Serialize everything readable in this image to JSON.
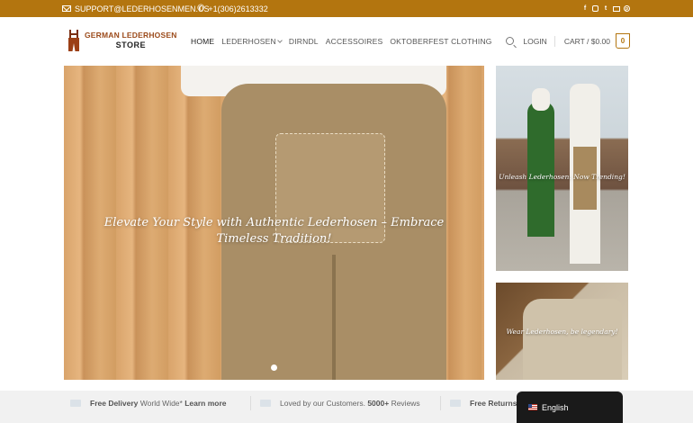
{
  "topbar": {
    "email": "SUPPORT@LEDERHOSENMEN.US",
    "phone": "+1(306)2613332",
    "social_icons": [
      "facebook-icon",
      "instagram-icon",
      "twitter-icon",
      "email-icon",
      "pinterest-icon"
    ],
    "background_color": "#b3750f"
  },
  "logo": {
    "line1": "GERMAN LEDERHOSEN",
    "line2": "STORE"
  },
  "nav": {
    "items": [
      {
        "label": "HOME",
        "active": true
      },
      {
        "label": "LEDERHOSEN",
        "dropdown": true
      },
      {
        "label": "DIRNDL"
      },
      {
        "label": "ACCESSOIRES"
      },
      {
        "label": "OKTOBERFEST CLOTHING"
      }
    ]
  },
  "account": {
    "login_label": "LOGIN",
    "cart_label": "CART / $0.00",
    "cart_count": "0"
  },
  "hero": {
    "caption": "Elevate Your Style with Authentic Lederhosen – Embrace Timeless Tradition!"
  },
  "side_banners": [
    {
      "caption": "Unleash Lederhosen: Now Trending!"
    },
    {
      "caption": "Wear Lederhosen, be legendary!"
    }
  ],
  "features": [
    {
      "bold": "Free Delivery",
      "text": " World Wide* ",
      "link": "Learn more"
    },
    {
      "text": "Loved by our Customers. ",
      "bold": "5000+",
      "text2": " Reviews"
    },
    {
      "bold": "Free Returns"
    }
  ],
  "language": {
    "label": "English"
  }
}
